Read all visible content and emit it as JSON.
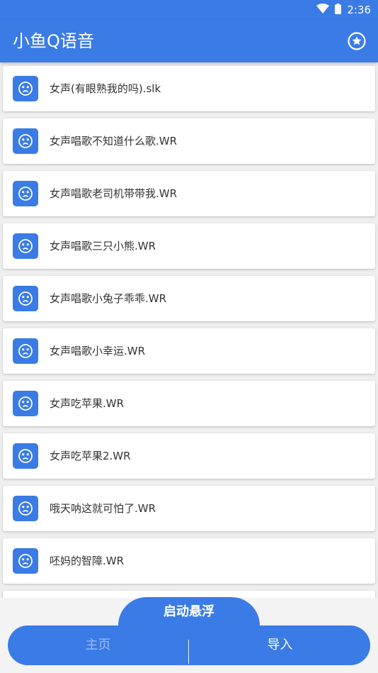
{
  "status_bar": {
    "time": "2:36"
  },
  "app_bar": {
    "title": "小鱼Q语音",
    "action_icon": "star-circle-icon"
  },
  "list": {
    "items": [
      {
        "label": "女声(有眼熟我的吗).slk"
      },
      {
        "label": "女声唱歌不知道什么歌.WR"
      },
      {
        "label": "女声唱歌老司机带带我.WR"
      },
      {
        "label": "女声唱歌三只小熊.WR"
      },
      {
        "label": "女声唱歌小兔子乖乖.WR"
      },
      {
        "label": "女声唱歌小幸运.WR"
      },
      {
        "label": "女声吃苹果.WR"
      },
      {
        "label": "女声吃苹果2.WR"
      },
      {
        "label": "哦天呐这就可怕了.WR"
      },
      {
        "label": "呸妈的智障.WR"
      },
      {
        "label": ""
      }
    ]
  },
  "bottom": {
    "float_button": "启动悬浮",
    "tabs": {
      "home": "主页",
      "import": "导入"
    }
  },
  "colors": {
    "primary": "#3a7be6",
    "inactive_tab": "#9dbcf3"
  }
}
